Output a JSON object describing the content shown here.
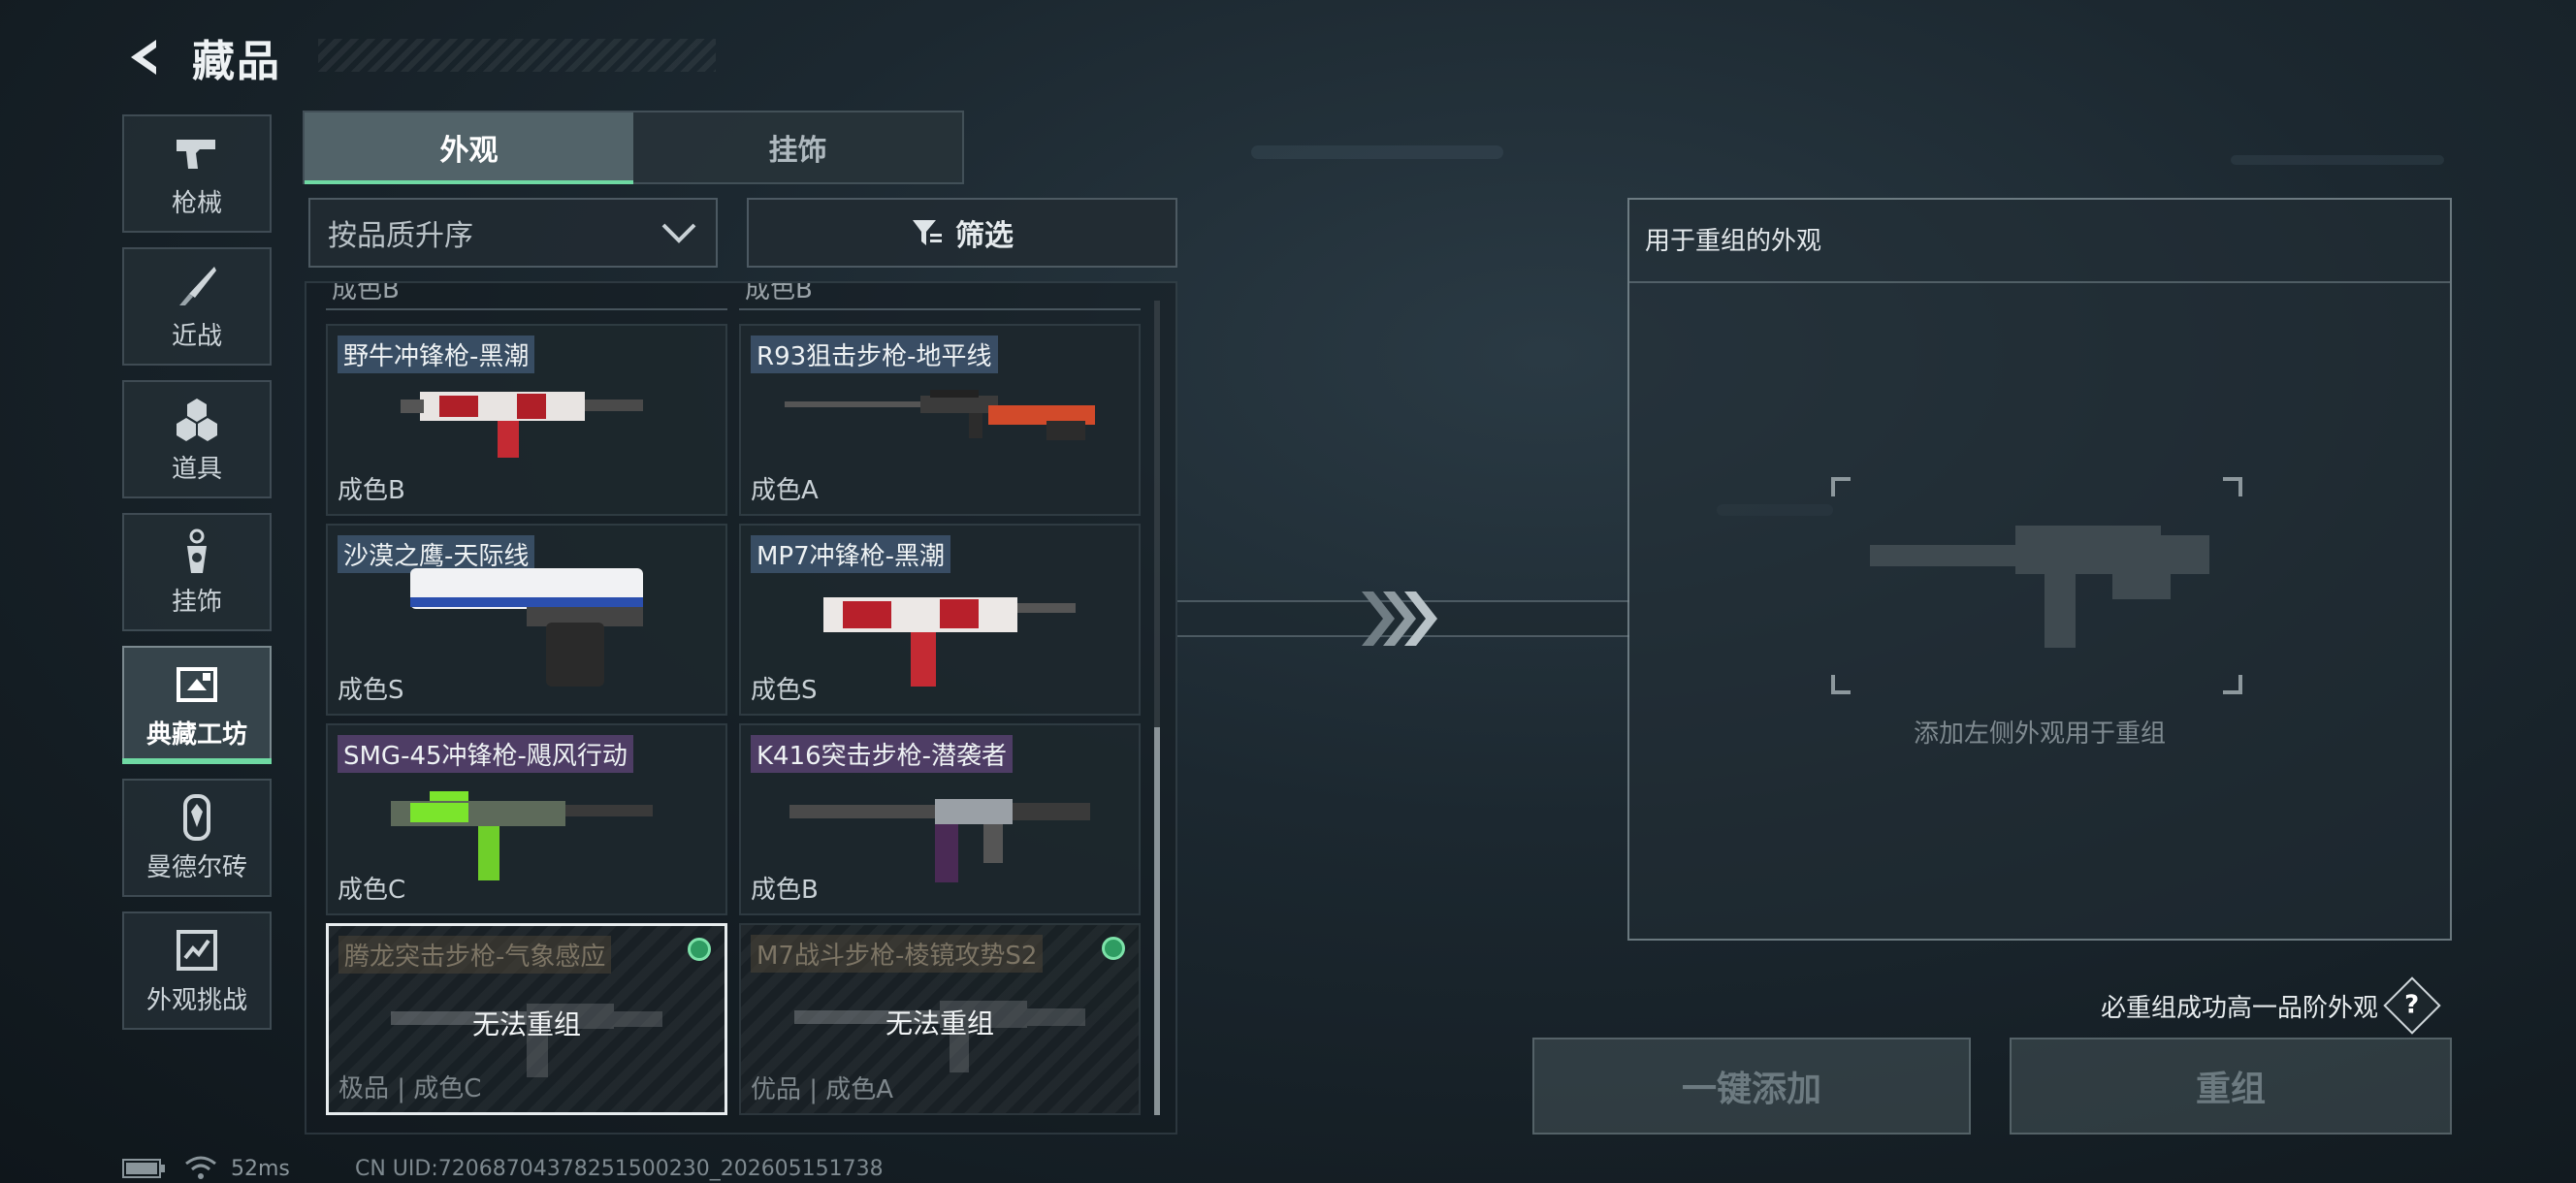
{
  "header": {
    "title": "藏品",
    "back_icon": "back-chevron-icon"
  },
  "categories": [
    {
      "label": "枪械",
      "icon": "pistol-icon",
      "active": false
    },
    {
      "label": "近战",
      "icon": "knife-icon",
      "active": false
    },
    {
      "label": "道具",
      "icon": "hexagon-items-icon",
      "active": false
    },
    {
      "label": "挂饰",
      "icon": "charm-icon",
      "active": false
    },
    {
      "label": "典藏工坊",
      "icon": "workshop-icon",
      "active": true
    },
    {
      "label": "曼德尔砖",
      "icon": "mandel-brick-icon",
      "active": false
    },
    {
      "label": "外观挑战",
      "icon": "challenge-icon",
      "active": false
    }
  ],
  "tabs": [
    {
      "label": "外观",
      "active": true
    },
    {
      "label": "挂饰",
      "active": false
    }
  ],
  "sort": {
    "label": "按品质升序"
  },
  "filter": {
    "label": "筛选"
  },
  "partial_top": {
    "left": "成色B",
    "right": "成色B"
  },
  "items": [
    {
      "name": "野牛冲锋枪-黑潮",
      "grade": "成色B",
      "tone": "blue",
      "locked": false
    },
    {
      "name": "R93狙击步枪-地平线",
      "grade": "成色A",
      "tone": "blue",
      "locked": false
    },
    {
      "name": "沙漠之鹰-天际线",
      "grade": "成色S",
      "tone": "blue",
      "locked": false
    },
    {
      "name": "MP7冲锋枪-黑潮",
      "grade": "成色S",
      "tone": "blue",
      "locked": false
    },
    {
      "name": "SMG-45冲锋枪-飓风行动",
      "grade": "成色C",
      "tone": "purple",
      "locked": false
    },
    {
      "name": "K416突击步枪-潜袭者",
      "grade": "成色B",
      "tone": "purple",
      "locked": false
    },
    {
      "name": "腾龙突击步枪-气象感应",
      "grade": "极品 | 成色C",
      "tone": "gold",
      "locked": true,
      "locked_text": "无法重组",
      "selected": true
    },
    {
      "name": "M7战斗步枪-棱镜攻势S2",
      "grade": "优品 | 成色A",
      "tone": "gold",
      "locked": true,
      "locked_text": "无法重组",
      "selected": false
    }
  ],
  "reorg": {
    "title": "用于重组的外观",
    "hint": "添加左侧外观用于重组",
    "guarantee_text": "必重组成功高一品阶外观",
    "help_label": "?"
  },
  "actions": {
    "add_all": "一键添加",
    "reorganize": "重组"
  },
  "status": {
    "ping": "52ms",
    "uid": "CN UID:720687043782515002​30_202605151738"
  },
  "colors": {
    "accent_green": "#6fd9a3",
    "name_tag_blue": "#50708f",
    "name_tag_purple": "#78509a"
  }
}
